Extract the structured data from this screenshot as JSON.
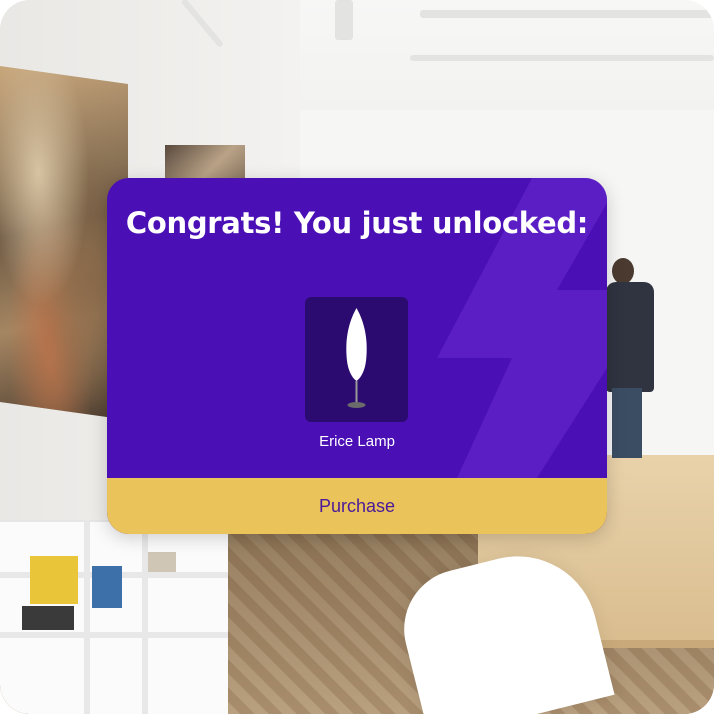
{
  "modal": {
    "title": "Congrats! You just unlocked:",
    "item_name": "Erice Lamp",
    "item_icon": "floor-lamp-icon",
    "purchase_label": "Purchase"
  },
  "colors": {
    "card_background": "#4a0fb5",
    "item_tile": "#2b0b6f",
    "purchase_button": "#eac35a",
    "purchase_text": "#4a1a9a"
  }
}
